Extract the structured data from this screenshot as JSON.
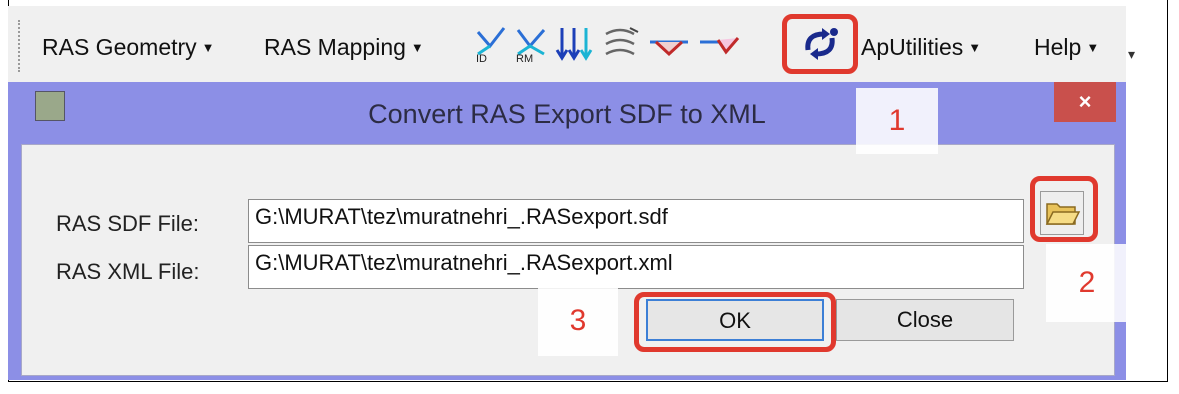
{
  "toolbar": {
    "menus": [
      {
        "label": "RAS Geometry"
      },
      {
        "label": "RAS Mapping"
      },
      {
        "label": "ApUtilities"
      },
      {
        "label": "Help"
      }
    ],
    "icons": [
      {
        "name": "cross-section-id-icon",
        "sub": "ID"
      },
      {
        "name": "cross-section-rm-icon",
        "sub": "RM"
      },
      {
        "name": "flow-arrows-icon"
      },
      {
        "name": "flowpaths-icon"
      },
      {
        "name": "channel-profile-icon"
      },
      {
        "name": "bank-profile-icon"
      },
      {
        "name": "convert-sdf-xml-icon"
      }
    ],
    "overflow_label": "▾"
  },
  "dialog": {
    "title": "Convert RAS Export SDF to XML",
    "close_label": "×",
    "sdf_label": "RAS SDF File:",
    "sdf_value": "G:\\MURAT\\tez\\muratnehri_.RASexport.sdf",
    "xml_label": "RAS XML File:",
    "xml_value": "G:\\MURAT\\tez\\muratnehri_.RASexport.xml",
    "ok_label": "OK",
    "close_button_label": "Close"
  },
  "callouts": [
    "1",
    "2",
    "3"
  ],
  "colors": {
    "highlight": "#e0392e",
    "dialog_frame": "#8c8fe6",
    "close_button": "#c9504c"
  }
}
